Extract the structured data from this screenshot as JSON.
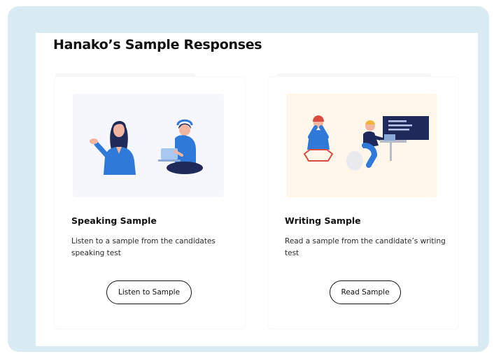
{
  "page": {
    "title": "Hanako’s Sample Responses"
  },
  "cards": [
    {
      "title": "Speaking Sample",
      "description": "Listen to a sample from the candidates speaking test",
      "button_label": "Listen to Sample",
      "illustration": "speaking-illustration"
    },
    {
      "title": "Writing Sample",
      "description": "Read a sample from the candidate’s writing test",
      "button_label": "Read Sample",
      "illustration": "writing-illustration"
    }
  ],
  "colors": {
    "frame": "#d8ebf2",
    "accent_blue": "#2f7ad9",
    "navy": "#1f2a5a",
    "red": "#d94a3f",
    "text": "#111111"
  }
}
